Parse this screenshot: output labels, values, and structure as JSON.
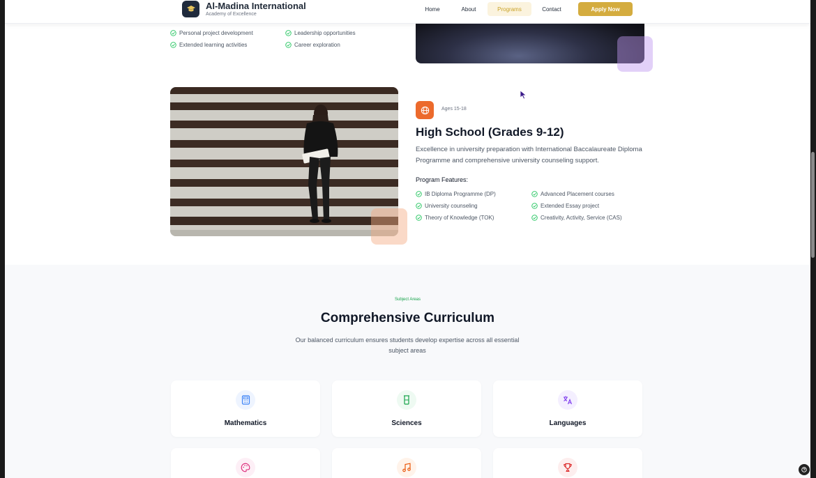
{
  "header": {
    "brand_name": "Al-Madina International",
    "brand_tagline": "Academy of Excellence",
    "nav": [
      {
        "label": "Home"
      },
      {
        "label": "About"
      },
      {
        "label": "Programs",
        "active": true
      },
      {
        "label": "Contact"
      }
    ],
    "apply_label": "Apply Now"
  },
  "middle_school": {
    "features": [
      "Personal project development",
      "Leadership opportunities",
      "Extended learning activities",
      "Career exploration"
    ]
  },
  "high_school": {
    "ages": "Ages 15-18",
    "title": "High School (Grades 9-12)",
    "description": "Excellence in university preparation with International Baccalaureate Diploma Programme and comprehensive university counseling support.",
    "features_label": "Program Features:",
    "features": [
      "IB Diploma Programme (DP)",
      "Advanced Placement courses",
      "University counseling",
      "Extended Essay project",
      "Theory of Knowledge (TOK)",
      "Creativity, Activity, Service (CAS)"
    ]
  },
  "curriculum": {
    "eyebrow": "Subject Areas",
    "title": "Comprehensive Curriculum",
    "description": "Our balanced curriculum ensures students develop expertise across all essential subject areas",
    "subjects": [
      {
        "label": "Mathematics",
        "icon": "calculator-icon",
        "color": "#3b82f6"
      },
      {
        "label": "Sciences",
        "icon": "beaker-icon",
        "color": "#16a34a"
      },
      {
        "label": "Languages",
        "icon": "translate-icon",
        "color": "#7c3aed"
      },
      {
        "label": "",
        "icon": "palette-icon",
        "color": "#db2777"
      },
      {
        "label": "",
        "icon": "music-note-icon",
        "color": "#ea580c"
      },
      {
        "label": "",
        "icon": "trophy-icon",
        "color": "#dc2626"
      }
    ]
  },
  "colors": {
    "gold": "#d4ac3f",
    "navy": "#1f2a3c",
    "orange": "#ec6a2c",
    "check_green": "#22c55e"
  }
}
